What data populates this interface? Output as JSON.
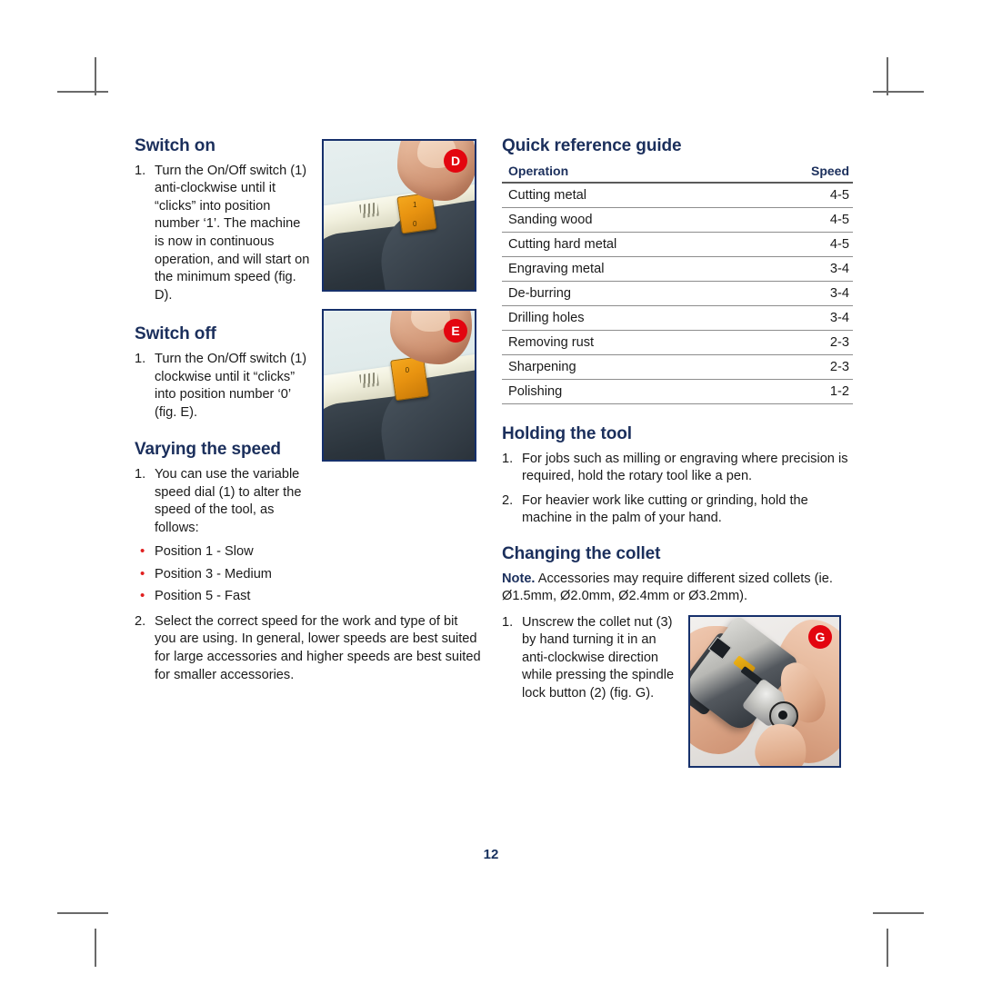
{
  "page": {
    "number": "12"
  },
  "left_column": {
    "switch_on": {
      "heading": "Switch on",
      "steps": [
        {
          "num": "1.",
          "text": "Turn the On/Off switch (1) anti-clockwise until it “clicks” into position number ‘1’. The machine is now in continuous operation, and will start on the minimum speed (fig. D)."
        }
      ]
    },
    "switch_off": {
      "heading": "Switch off",
      "steps": [
        {
          "num": "1.",
          "text": "Turn the On/Off switch (1) clockwise until it “clicks” into position number ‘0’ (fig. E)."
        }
      ]
    },
    "varying_speed": {
      "heading": "Varying the speed",
      "step1": {
        "num": "1.",
        "text": "You can use the variable speed dial (1) to alter the speed of the tool, as follows:"
      },
      "bullets": [
        "Position 1 - Slow",
        "Position 3 - Medium",
        "Position 5 - Fast"
      ],
      "step2": {
        "num": "2.",
        "text": "Select the correct speed for the work and type of bit you are using. In general, lower speeds are best suited for large accessories and higher speeds are best suited for smaller accessories."
      }
    }
  },
  "right_column": {
    "quick_reference": {
      "heading": "Quick reference guide",
      "columns": [
        "Operation",
        "Speed"
      ],
      "rows": [
        {
          "operation": "Cutting metal",
          "speed": "4-5"
        },
        {
          "operation": "Sanding wood",
          "speed": "4-5"
        },
        {
          "operation": "Cutting hard metal",
          "speed": "4-5"
        },
        {
          "operation": "Engraving metal",
          "speed": "3-4"
        },
        {
          "operation": "De-burring",
          "speed": "3-4"
        },
        {
          "operation": "Drilling holes",
          "speed": "3-4"
        },
        {
          "operation": "Removing rust",
          "speed": "2-3"
        },
        {
          "operation": "Sharpening",
          "speed": "2-3"
        },
        {
          "operation": "Polishing",
          "speed": "1-2"
        }
      ]
    },
    "holding_tool": {
      "heading": "Holding the tool",
      "steps": [
        {
          "num": "1.",
          "text": "For jobs such as milling or engraving where precision is required, hold the rotary tool like a pen."
        },
        {
          "num": "2.",
          "text": "For heavier work like cutting or grinding, hold the machine in the palm of your hand."
        }
      ]
    },
    "changing_collet": {
      "heading": "Changing the collet",
      "note_label": "Note.",
      "note_text": " Accessories may require different sized collets (ie. Ø1.5mm, Ø2.0mm, Ø2.4mm or Ø3.2mm).",
      "steps": [
        {
          "num": "1.",
          "text": "Unscrew the collet nut (3) by hand turning it in an anti-clockwise direction while pressing the spindle lock button (2) (fig. G)."
        }
      ]
    }
  },
  "figures": {
    "d": {
      "badge": "D",
      "caption_ref": "fig. D",
      "switch_position": "1"
    },
    "e": {
      "badge": "E",
      "caption_ref": "fig. E",
      "switch_position": "0"
    },
    "g": {
      "badge": "G",
      "caption_ref": "fig. G"
    }
  },
  "colors": {
    "heading": "#1b2f5c",
    "bullet": "#e02020",
    "badge": "#e3050f",
    "figure_border": "#16306b",
    "page_number": "#16305e",
    "crop_mark": "#6a6a6a"
  }
}
